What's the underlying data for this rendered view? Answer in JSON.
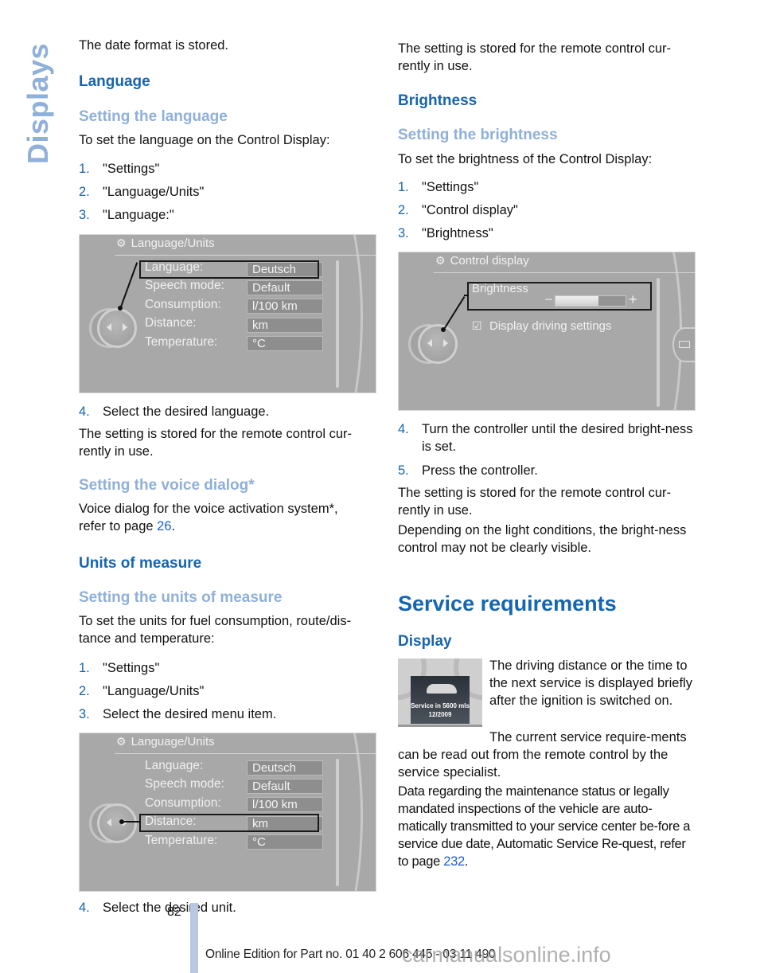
{
  "side_tab": "Displays",
  "left": {
    "intro": "The date format is stored.",
    "language_heading": "Language",
    "setting_language": {
      "heading": "Setting the language",
      "intro": "To set the language on the Control Display:",
      "steps": [
        {
          "num": "1.",
          "text": "\"Settings\""
        },
        {
          "num": "2.",
          "text": "\"Language/Units\""
        },
        {
          "num": "3.",
          "text": "\"Language:\""
        }
      ],
      "step4": {
        "num": "4.",
        "text": "Select the desired language."
      },
      "stored": "The setting is stored for the remote control cur-rently in use."
    },
    "voice_dialog": {
      "heading": "Setting the voice dialog*",
      "text_before": "Voice dialog for the voice activation system*, refer to page ",
      "page_link": "26",
      "text_after": "."
    },
    "units_heading": "Units of measure",
    "setting_units": {
      "heading": "Setting the units of measure",
      "intro": "To set the units for fuel consumption, route/dis-tance and temperature:",
      "steps": [
        {
          "num": "1.",
          "text": "\"Settings\""
        },
        {
          "num": "2.",
          "text": "\"Language/Units\""
        },
        {
          "num": "3.",
          "text": "Select the desired menu item."
        }
      ],
      "step4": {
        "num": "4.",
        "text": "Select the desired unit."
      }
    }
  },
  "screen_language_units": {
    "title": "Language/Units",
    "gear_icon": "gear-icon",
    "rows": [
      {
        "label": "Language:",
        "value": "Deutsch"
      },
      {
        "label": "Speech mode:",
        "value": "Default"
      },
      {
        "label": "Consumption:",
        "value": "l/100 km"
      },
      {
        "label": "Distance:",
        "value": "km"
      },
      {
        "label": "Temperature:",
        "value": "°C"
      }
    ],
    "selected_first": "Language:",
    "selected_second": "Distance:"
  },
  "right": {
    "stored": "The setting is stored for the remote control cur-rently in use.",
    "brightness_heading": "Brightness",
    "setting_brightness": {
      "heading": "Setting the brightness",
      "intro": "To set the brightness of the Control Display:",
      "steps": [
        {
          "num": "1.",
          "text": "\"Settings\""
        },
        {
          "num": "2.",
          "text": "\"Control display\""
        },
        {
          "num": "3.",
          "text": "\"Brightness\""
        }
      ],
      "steps_after": [
        {
          "num": "4.",
          "text": "Turn the controller until the desired bright-ness is set."
        },
        {
          "num": "5.",
          "text": "Press the controller."
        }
      ],
      "stored": "The setting is stored for the remote control cur-rently in use.",
      "note": "Depending on the light conditions, the bright-ness control may not be clearly visible."
    },
    "service_heading": "Service requirements",
    "display_heading": "Display",
    "service_p1": "The driving distance or the time to the next service is displayed briefly after the ignition is switched on.",
    "service_p2": "The current service require-ments can be read out from the remote control by the service specialist.",
    "service_p3_before": "Data regarding the maintenance status or legally mandated inspections of the vehicle are auto-matically transmitted to your service center be-fore a service due date, Automatic Service Re-quest, refer to page ",
    "service_p3_link": "232",
    "service_p3_after": "."
  },
  "screen_control_display": {
    "title": "Control display",
    "brightness_label": "Brightness",
    "minus": "–",
    "plus": "+",
    "brightness_level_percent": 61,
    "checkbox_label": "Display driving settings",
    "checkbox_checked": true
  },
  "service_image": {
    "line1": "Service in 5600 mls",
    "line2": "12/2009"
  },
  "footer": {
    "page_number": "82",
    "edition": "Online Edition for Part no. 01 40 2 606 445 - 03 11 490",
    "watermark": "carmanualsonline.info"
  },
  "colors": {
    "heading_blue": "#1565b0",
    "subheading_light_blue": "#8fb0d8",
    "link_blue": "#1a5fd6"
  }
}
